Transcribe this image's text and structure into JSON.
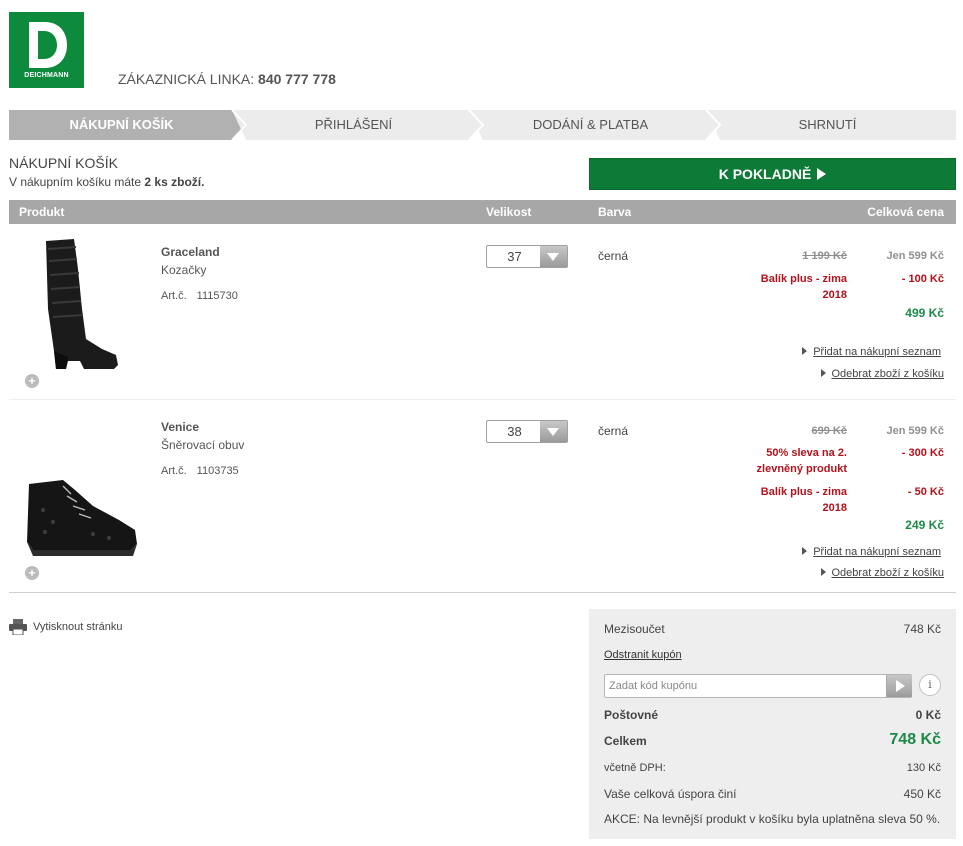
{
  "brand": {
    "logo_text": "DEICHMANN",
    "color": "#0d8a3b"
  },
  "header": {
    "hotline_label": "ZÁKAZNICKÁ LINKA:",
    "hotline_number": "840 777 778"
  },
  "steps": [
    {
      "label": "NÁKUPNÍ KOŠÍK",
      "active": true
    },
    {
      "label": "PŘIHLÁŠENÍ",
      "active": false
    },
    {
      "label": "DODÁNÍ & PLATBA",
      "active": false
    },
    {
      "label": "SHRNUTÍ",
      "active": false
    }
  ],
  "cart": {
    "title": "NÁKUPNÍ KOŠÍK",
    "sub_prefix": "V nákupním košíku máte",
    "sub_count": "2 ks zboží.",
    "checkout_label": "K POKLADNĚ"
  },
  "table": {
    "headers": {
      "product": "Produkt",
      "size": "Velikost",
      "color": "Barva",
      "total": "Celková cena"
    }
  },
  "items": [
    {
      "name": "Graceland",
      "type": "Kozačky",
      "art_label": "Art.č.",
      "art_number": "1115730",
      "size": "37",
      "color": "černá",
      "old_price": "1 199 Kč",
      "jen_price": "Jen 599 Kč",
      "promos": [
        {
          "text": "Balík plus - zima 2018",
          "amount": "- 100 Kč"
        }
      ],
      "final_price": "499 Kč",
      "add_to_list": "Přidat na nákupní seznam",
      "remove": "Odebrat zboží z košíku"
    },
    {
      "name": "Venice",
      "type": "Šněrovací obuv",
      "art_label": "Art.č.",
      "art_number": "1103735",
      "size": "38",
      "color": "černá",
      "old_price": "699 Kč",
      "jen_price": "Jen 599 Kč",
      "promos": [
        {
          "text": "50% sleva na 2. zlevněný produkt",
          "amount": "- 300 Kč"
        },
        {
          "text": "Balík plus - zima 2018",
          "amount": "- 50 Kč"
        }
      ],
      "final_price": "249 Kč",
      "add_to_list": "Přidat na nákupní seznam",
      "remove": "Odebrat zboží z košíku"
    }
  ],
  "print_label": "Vytisknout stránku",
  "summary": {
    "subtotal_label": "Mezisoučet",
    "subtotal_value": "748 Kč",
    "remove_coupon": "Odstranit kupón",
    "coupon_placeholder": "Zadat kód kupónu",
    "info_glyph": "i",
    "shipping_label": "Poštovné",
    "shipping_value": "0 Kč",
    "total_label": "Celkem",
    "total_value": "748 Kč",
    "vat_label": "včetně DPH:",
    "vat_value": "130 Kč",
    "savings_label": "Vaše celková úspora činí",
    "savings_value": "450 Kč",
    "akce_note": "AKCE: Na levnější produkt v košíku byla uplatněna sleva 50 %."
  }
}
